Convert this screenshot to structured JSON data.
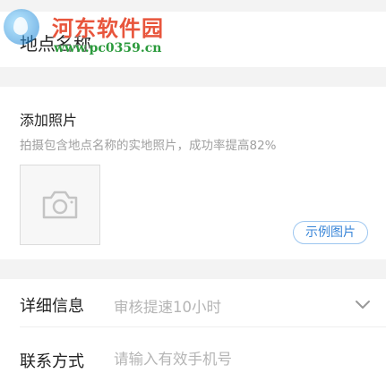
{
  "place": {
    "label": "地点名称"
  },
  "watermark": {
    "title": "河东软件园",
    "url": "www.pc0359.cn"
  },
  "photo": {
    "title": "添加照片",
    "hint": "拍摄包含地点名称的实地照片，成功率提高82%",
    "sample_button": "示例图片",
    "add_icon": "camera-icon"
  },
  "detail": {
    "label": "详细信息",
    "value": "审核提速10小时",
    "icon": "chevron-down-icon"
  },
  "contact": {
    "label": "联系方式",
    "placeholder": "请输入有效手机号"
  },
  "colors": {
    "accent": "#3a86d8",
    "band": "#f3f3f3",
    "hint": "#a0a0a0"
  }
}
